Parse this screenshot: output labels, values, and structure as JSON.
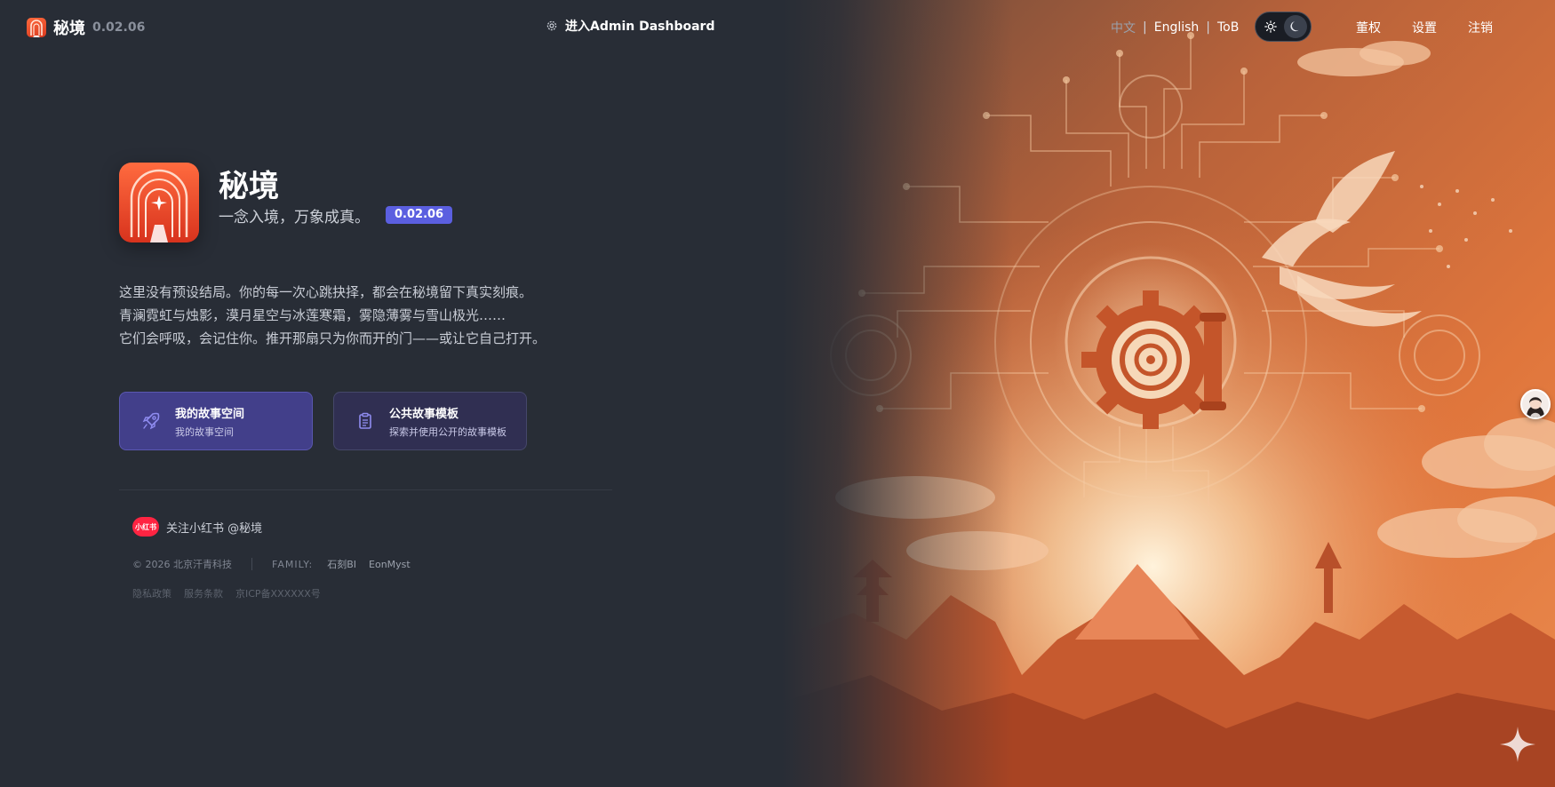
{
  "header": {
    "brand_name": "秘境",
    "brand_version": "0.02.06",
    "admin_link": "进入Admin Dashboard",
    "languages": [
      "中文",
      "English",
      "ToB"
    ],
    "separator": "|",
    "nav": {
      "auth": "董权",
      "settings": "设置",
      "logout": "注销"
    }
  },
  "hero": {
    "title": "秘境",
    "slogan": "一念入境，万象成真。",
    "version": "0.02.06",
    "description": [
      "这里没有预设结局。你的每一次心跳抉择，都会在秘境留下真实刻痕。",
      "青澜霓虹与烛影，漠月星空与冰莲寒霜，雾隐薄雾与雪山极光……",
      "它们会呼吸，会记住你。推开那扇只为你而开的门——或让它自己打开。"
    ]
  },
  "cards": {
    "my_space": {
      "title": "我的故事空间",
      "subtitle": "我的故事空间"
    },
    "templates": {
      "title": "公共故事模板",
      "subtitle": "探索并使用公开的故事模板"
    }
  },
  "footer": {
    "xhs_logo": "小红书",
    "xhs_follow": "关注小红书 @秘境",
    "copyright": "© 2026 北京汗青科技",
    "family_label": "FAMILY:",
    "family_links": [
      "石刻BI",
      "EonMyst"
    ],
    "legal": [
      "隐私政策",
      "服务条款",
      "京ICP备XXXXXX号"
    ]
  },
  "colors": {
    "background": "#282d36",
    "accent": "#5b5fe0",
    "primary_card": "#423f8a",
    "art_orange": "#e8804a"
  }
}
